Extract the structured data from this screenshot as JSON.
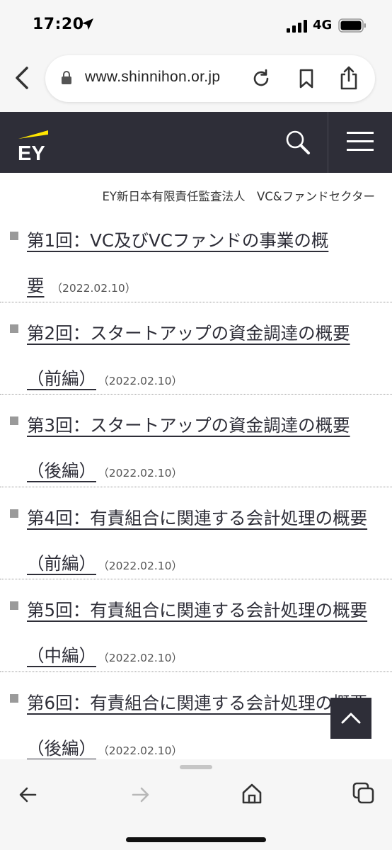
{
  "status_bar": {
    "time": "17:20",
    "network": "4G",
    "icons": [
      "location-arrow-icon",
      "signal-icon",
      "battery-icon"
    ]
  },
  "browser": {
    "url": "www.shinnihon.or.jp",
    "icons": [
      "back-chevron-icon",
      "lock-icon",
      "reload-icon",
      "bookmark-icon",
      "share-icon"
    ]
  },
  "header": {
    "logo": "EY",
    "accent_color": "#ffe600",
    "background_color": "#2e2e38",
    "icons": [
      "search-icon",
      "hamburger-menu-icon"
    ]
  },
  "byline": "EY新日本有限責任監査法人　VC&ファンドセクター",
  "articles": [
    {
      "line1": "第1回：VC及びVCファンドの事業の概",
      "line2": "要",
      "date": "（2022.02.10）"
    },
    {
      "line1": "第2回：スタートアップの資金調達の概要",
      "line2": "（前編）",
      "date": "（2022.02.10）"
    },
    {
      "line1": "第3回：スタートアップの資金調達の概要",
      "line2": "（後編）",
      "date": "（2022.02.10）"
    },
    {
      "line1": "第4回：有責組合に関連する会計処理の概要",
      "line2": "（前編）",
      "date": "（2022.02.10）"
    },
    {
      "line1": "第5回：有責組合に関連する会計処理の概要",
      "line2": "（中編）",
      "date": "（2022.02.10）"
    },
    {
      "line1": "第6回：有責組合に関連する会計処理の概要",
      "line2": "（後編）",
      "date": "（2022.02.10）"
    }
  ],
  "bottom_nav": {
    "icons": [
      "back-arrow-icon",
      "forward-arrow-icon",
      "home-icon",
      "tabs-icon",
      "scroll-to-top-icon"
    ]
  }
}
